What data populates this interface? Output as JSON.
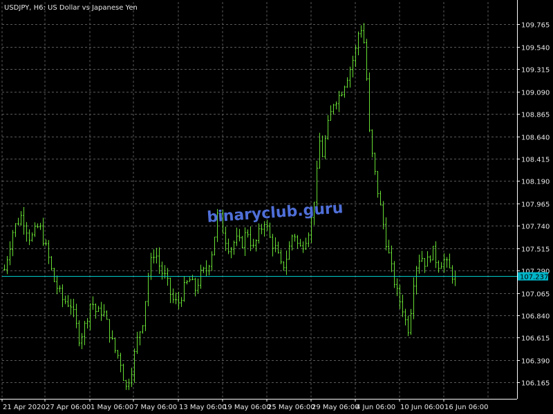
{
  "chart_title": "USDJPY, H6: US Dollar vs Japanese Yen",
  "watermark": "binaryclub.guru",
  "current_price_label": "107.237",
  "colors": {
    "background": "#000000",
    "grid": "#5a5a5a",
    "axis": "#ffffff",
    "bars": "#66dd33",
    "price_line": "#00cccc",
    "price_tag": "#00b4c8",
    "watermark": "#4f6fd8"
  },
  "chart_data": {
    "type": "ohlc",
    "symbol": "USDJPY",
    "timeframe": "H6",
    "title": "USDJPY, H6: US Dollar vs Japanese Yen",
    "grid": true,
    "ylim": [
      106.0,
      109.99
    ],
    "current_price": 107.237,
    "y_ticks": [
      "109.765",
      "109.540",
      "109.315",
      "109.090",
      "108.865",
      "108.640",
      "108.415",
      "108.190",
      "107.965",
      "107.740",
      "107.515",
      "107.290",
      "107.065",
      "106.840",
      "106.615",
      "106.390",
      "106.165"
    ],
    "x_ticks": [
      "21 Apr 2020",
      "27 Apr 06:00",
      "1 May 06:00",
      "7 May 06:00",
      "13 May 06:00",
      "19 May 06:00",
      "25 May 06:00",
      "29 May 06:00",
      "4 Jun 06:00",
      "10 Jun 06:00",
      "16 Jun 06:00"
    ],
    "close_path": [
      [
        0,
        107.3
      ],
      [
        3,
        107.7
      ],
      [
        6,
        107.85
      ],
      [
        9,
        107.6
      ],
      [
        12,
        107.75
      ],
      [
        15,
        107.45
      ],
      [
        17,
        107.2
      ],
      [
        20,
        107.0
      ],
      [
        23,
        106.95
      ],
      [
        26,
        106.6
      ],
      [
        28,
        106.75
      ],
      [
        30,
        107.0
      ],
      [
        32,
        106.85
      ],
      [
        34,
        106.9
      ],
      [
        36,
        106.7
      ],
      [
        38,
        106.5
      ],
      [
        40,
        106.4
      ],
      [
        42,
        106.1
      ],
      [
        44,
        106.3
      ],
      [
        46,
        106.6
      ],
      [
        48,
        106.8
      ],
      [
        50,
        107.3
      ],
      [
        52,
        107.5
      ],
      [
        54,
        107.3
      ],
      [
        56,
        107.2
      ],
      [
        58,
        107.0
      ],
      [
        60,
        106.95
      ],
      [
        62,
        107.1
      ],
      [
        64,
        107.2
      ],
      [
        66,
        107.1
      ],
      [
        68,
        107.25
      ],
      [
        70,
        107.3
      ],
      [
        72,
        107.5
      ],
      [
        74,
        107.9
      ],
      [
        76,
        107.65
      ],
      [
        78,
        107.5
      ],
      [
        80,
        107.6
      ],
      [
        82,
        107.55
      ],
      [
        84,
        107.7
      ],
      [
        86,
        107.5
      ],
      [
        88,
        107.65
      ],
      [
        90,
        107.8
      ],
      [
        92,
        107.6
      ],
      [
        94,
        107.5
      ],
      [
        96,
        107.3
      ],
      [
        98,
        107.45
      ],
      [
        100,
        107.7
      ],
      [
        102,
        107.5
      ],
      [
        104,
        107.6
      ],
      [
        106,
        107.75
      ],
      [
        108,
        108.2
      ],
      [
        109,
        108.6
      ],
      [
        110,
        108.45
      ],
      [
        112,
        108.75
      ],
      [
        114,
        109.0
      ],
      [
        116,
        109.05
      ],
      [
        118,
        109.2
      ],
      [
        120,
        109.35
      ],
      [
        122,
        109.55
      ],
      [
        123,
        109.8
      ],
      [
        124,
        109.65
      ],
      [
        125,
        109.5
      ],
      [
        126,
        108.75
      ],
      [
        127,
        108.5
      ],
      [
        128,
        108.3
      ],
      [
        130,
        107.95
      ],
      [
        132,
        107.6
      ],
      [
        134,
        107.3
      ],
      [
        136,
        107.05
      ],
      [
        138,
        106.9
      ],
      [
        139,
        106.75
      ],
      [
        140,
        106.7
      ],
      [
        141,
        107.0
      ],
      [
        142,
        107.3
      ],
      [
        144,
        107.45
      ],
      [
        146,
        107.35
      ],
      [
        148,
        107.5
      ],
      [
        150,
        107.35
      ],
      [
        152,
        107.4
      ],
      [
        154,
        107.3
      ],
      [
        156,
        107.2
      ]
    ]
  }
}
